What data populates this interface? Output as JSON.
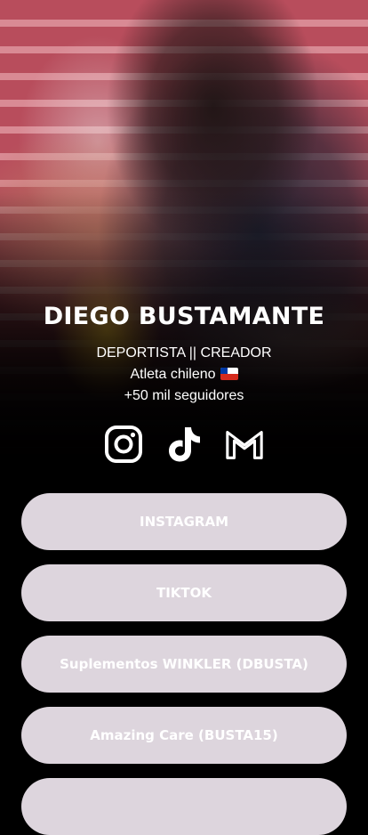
{
  "profile": {
    "name": "DIEGO BUSTAMANTE",
    "bio_line1": "DEPORTISTA || CREADOR",
    "bio_line2": "Atleta chileno",
    "bio_line3": "+50 mil seguidores",
    "flag_icon": "chile-flag-icon"
  },
  "social_icons": [
    "instagram-icon",
    "tiktok-icon",
    "gmail-icon"
  ],
  "links": [
    {
      "label": "INSTAGRAM"
    },
    {
      "label": "TIKTOK"
    },
    {
      "label": "Suplementos WINKLER (DBUSTA)"
    },
    {
      "label": "Amazing Care (BUSTA15)"
    },
    {
      "label": ""
    }
  ],
  "colors": {
    "background": "#000000",
    "button_bg": "#ddd5dd",
    "button_text": "#ffffff",
    "text": "#ffffff"
  }
}
